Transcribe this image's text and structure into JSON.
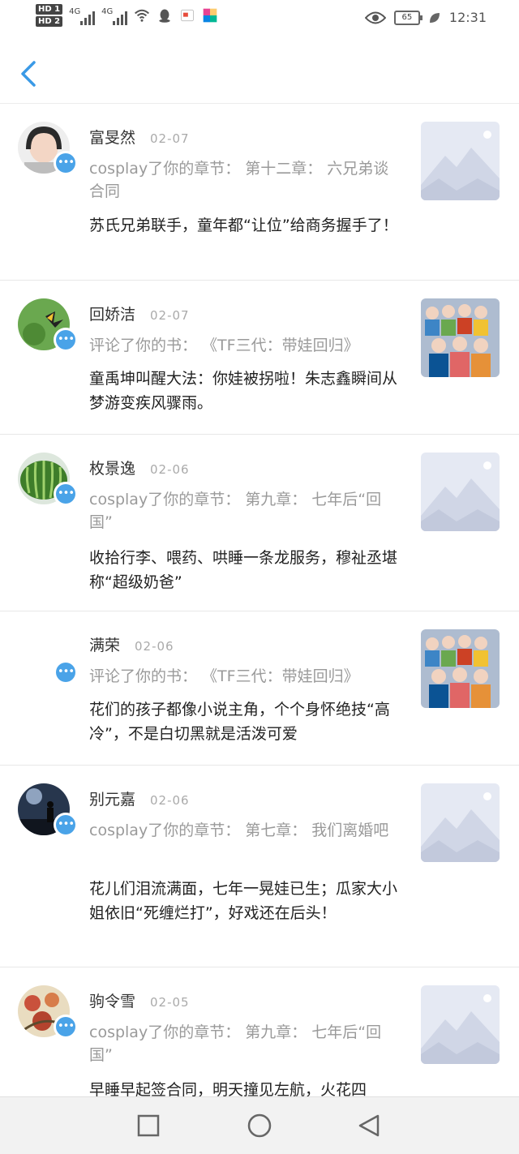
{
  "status_bar": {
    "sim1": "HD 1",
    "sim2": "HD 2",
    "net1": "4G",
    "net2": "4G",
    "battery": "65",
    "time": "12:31"
  },
  "colors": {
    "accent": "#4aa3e8",
    "placeholder_bg": "#e5e9f3",
    "divider": "#e8e8e8"
  },
  "icons": {
    "back": "chevron-left-icon",
    "badge": "comment-bubble-icon",
    "nav_recent": "square-icon",
    "nav_home": "circle-icon",
    "nav_back": "triangle-back-icon"
  },
  "notifications": [
    {
      "name": "富旻然",
      "date": "02-07",
      "action": "cosplay了你的章节：  第十二章：  六兄弟谈合同",
      "comment": "苏氏兄弟联手，童年都“让位”给商务握手了！",
      "avatar_desc": "girl-portrait",
      "thumb": "placeholder"
    },
    {
      "name": "回娇洁",
      "date": "02-07",
      "action": "评论了你的书：  《TF三代：带娃回归》",
      "comment": "童禹坤叫醒大法：你娃被拐啦！朱志鑫瞬间从梦游变疾风骤雨。",
      "avatar_desc": "butterfly",
      "thumb": "group-photo"
    },
    {
      "name": "枚景逸",
      "date": "02-06",
      "action": "cosplay了你的章节：  第九章：  七年后“回国”",
      "comment": "收拾行李、喂药、哄睡一条龙服务，穆祉丞堪称“超级奶爸”",
      "avatar_desc": "watermelon",
      "thumb": "placeholder"
    },
    {
      "name": "满荣",
      "date": "02-06",
      "action": "评论了你的书：  《TF三代：带娃回归》",
      "comment": "花们的孩子都像小说主角，个个身怀绝技“高冷”，不是白切黑就是活泼可爱",
      "avatar_desc": "none",
      "thumb": "group-photo"
    },
    {
      "name": "别元嘉",
      "date": "02-06",
      "action": "cosplay了你的章节：  第七章：  我们离婚吧",
      "comment": "花儿们泪流满面，七年一晃娃已生；瓜家大小姐依旧“死缠烂打”，好戏还在后头！",
      "avatar_desc": "night-sky",
      "thumb": "placeholder"
    },
    {
      "name": "驹令雪",
      "date": "02-05",
      "action": "cosplay了你的章节：  第九章：  七年后“回国”",
      "comment": "早睡早起签合同，明天撞见左航，火花四",
      "avatar_desc": "painting",
      "thumb": "placeholder"
    }
  ]
}
